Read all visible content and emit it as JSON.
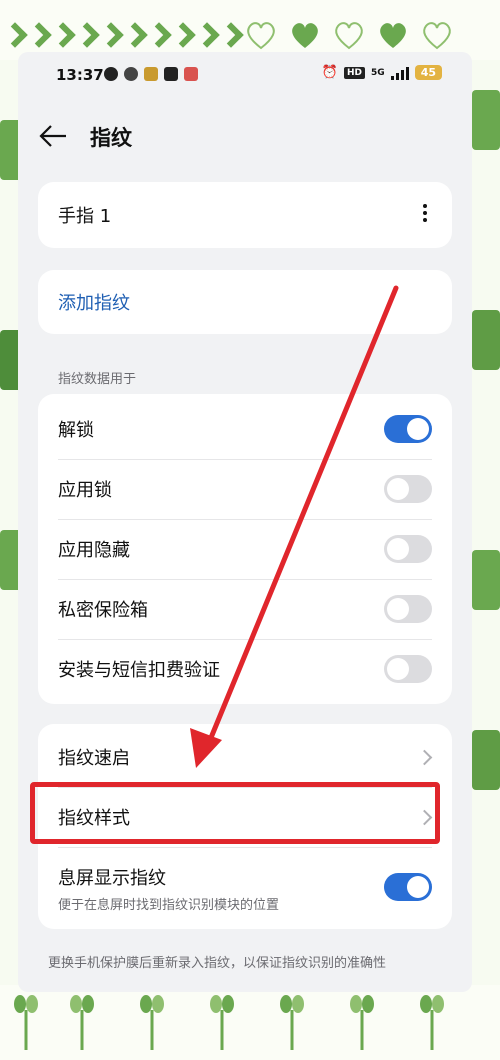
{
  "status_bar": {
    "time": "13:37",
    "hd": "HD",
    "network": "5G",
    "battery": "45"
  },
  "header": {
    "title": "指纹"
  },
  "finger_card": {
    "label": "手指 1"
  },
  "add_card": {
    "label": "添加指纹"
  },
  "usage_section": {
    "title": "指纹数据用于",
    "items": [
      {
        "label": "解锁",
        "enabled": true
      },
      {
        "label": "应用锁",
        "enabled": false
      },
      {
        "label": "应用隐藏",
        "enabled": false
      },
      {
        "label": "私密保险箱",
        "enabled": false
      },
      {
        "label": "安装与短信扣费验证",
        "enabled": false
      }
    ]
  },
  "more_card": {
    "quick_start": "指纹速启",
    "style": "指纹样式",
    "screen_off_title": "息屏显示指纹",
    "screen_off_sub": "便于在息屏时找到指纹识别模块的位置",
    "screen_off_enabled": true
  },
  "footer_note": "更换手机保护膜后重新录入指纹，以保证指纹识别的准确性",
  "colors": {
    "accent": "#2a6fd6",
    "link": "#1f5fb3",
    "annotation": "#e0262c",
    "frame_green": "#6aa84f"
  }
}
